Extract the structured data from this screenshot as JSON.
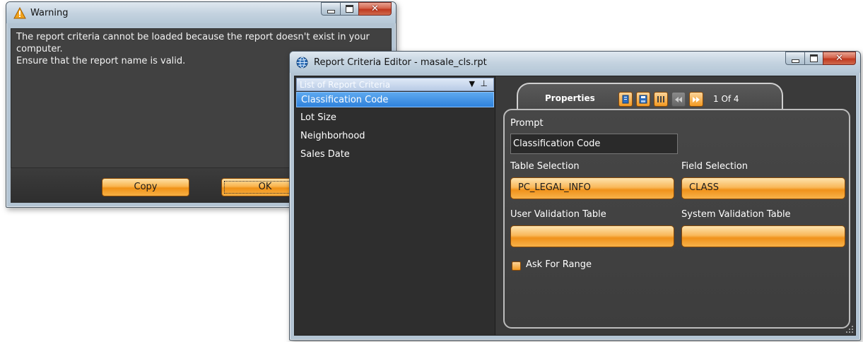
{
  "warning": {
    "title": "Warning",
    "icon": "warning-icon",
    "message_lines": [
      "The report criteria cannot be loaded because the report doesn't exist in your",
      "computer.",
      "Ensure that the report name is valid."
    ],
    "copy_label": "Copy",
    "ok_label": "OK"
  },
  "editor": {
    "title": "Report Criteria Editor - masale_cls.rpt",
    "icon": "globe-icon",
    "criteria_header": "List of Report Criteria",
    "criteria": [
      {
        "label": "Classification Code",
        "selected": true
      },
      {
        "label": "Lot Size",
        "selected": false
      },
      {
        "label": "Neighborhood",
        "selected": false
      },
      {
        "label": "Sales Date",
        "selected": false
      }
    ],
    "properties_tab": "Properties",
    "page_indicator": "1 Of 4",
    "prompt_label": "Prompt",
    "prompt_value": "Classification Code",
    "table_selection_label": "Table Selection",
    "table_selection_value": "PC_LEGAL_INFO",
    "field_selection_label": "Field Selection",
    "field_selection_value": "CLASS",
    "user_validation_label": "User Validation Table",
    "user_validation_value": "",
    "system_validation_label": "System Validation Table",
    "system_validation_value": "",
    "ask_for_range_label": "Ask For Range",
    "ask_for_range_checked": true
  },
  "colors": {
    "accent_orange": "#f39a22",
    "selection_blue": "#3b8ee6",
    "panel_dark": "#3a3a3a"
  }
}
